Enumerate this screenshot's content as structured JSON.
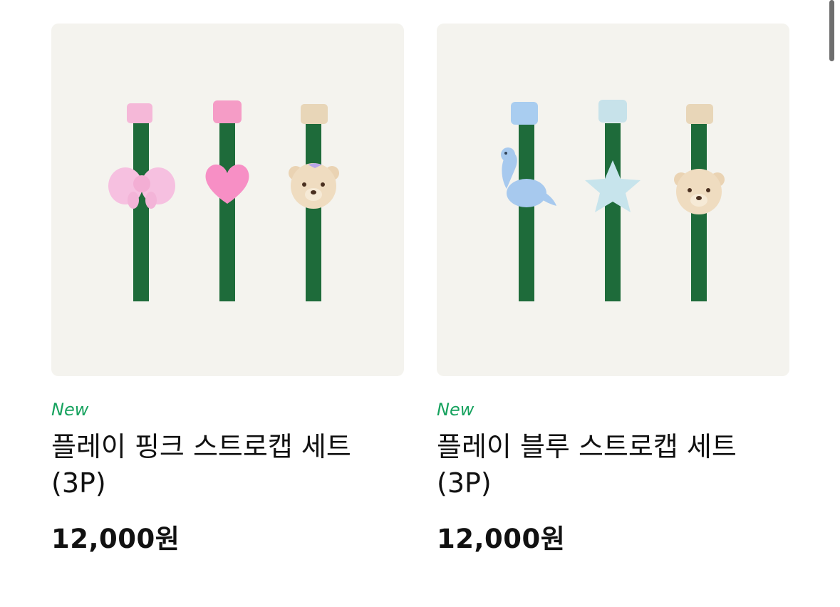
{
  "products": [
    {
      "badge": "New",
      "name": "플레이 핑크 스트로캡 세트 (3P)",
      "price": "12,000원",
      "image_icon": "pink-straw-caps-image",
      "colors": {
        "straw": "#1e6b3a",
        "cap1": "#f5b8d8",
        "cap2": "#f59cc6",
        "cap3": "#e8d6b8"
      }
    },
    {
      "badge": "New",
      "name": "플레이 블루 스트로캡 세트 (3P)",
      "price": "12,000원",
      "image_icon": "blue-straw-caps-image",
      "colors": {
        "straw": "#1e6b3a",
        "cap1": "#a9cdf0",
        "cap2": "#c7e2ea",
        "cap3": "#e8d6b8"
      }
    }
  ],
  "colors": {
    "badge": "#16a25e",
    "thumb_bg": "#f4f3ee",
    "text": "#111111"
  }
}
